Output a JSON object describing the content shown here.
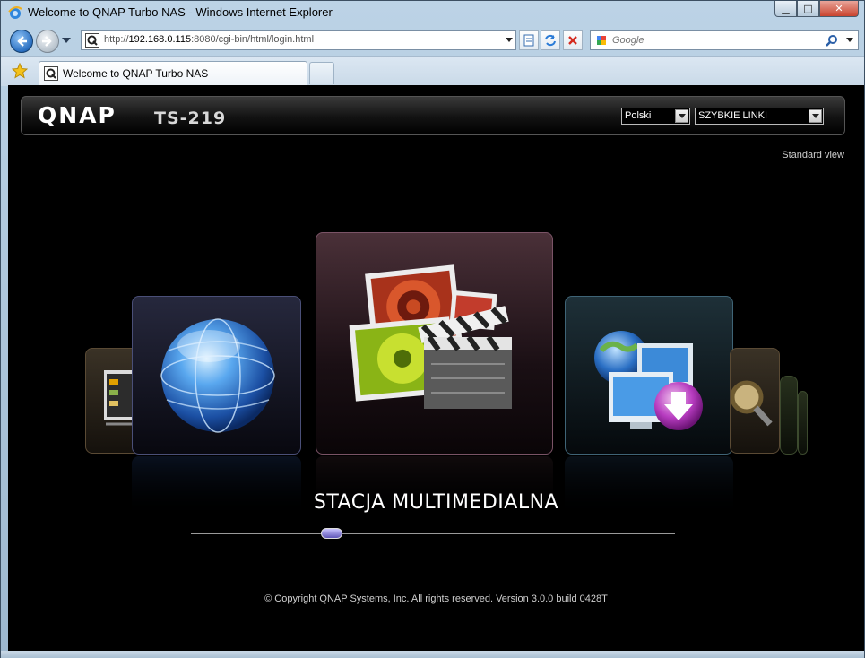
{
  "window": {
    "title": "Welcome to QNAP Turbo NAS - Windows Internet Explorer",
    "controls": {
      "minimize": "▁",
      "maximize": "□",
      "close": "✕"
    }
  },
  "navigation": {
    "url_prefix": "http://",
    "url_host": "192.168.0.115",
    "url_rest": ":8080/cgi-bin/html/login.html",
    "search_placeholder": "Google"
  },
  "tabs": [
    {
      "label": "Welcome to QNAP Turbo NAS",
      "active": true
    }
  ],
  "page": {
    "brand": "QNAP",
    "model": "TS-219",
    "language_select": "Polski",
    "quicklinks_select": "SZYBKIE LINKI",
    "standard_view_link": "Standard view",
    "carousel_caption": "STACJA MULTIMEDIALNA",
    "carousel_position": 0.29,
    "copyright": "© Copyright QNAP Systems, Inc. All rights reserved. Version 3.0.0 build 0428T",
    "carousel_items": [
      {
        "icon": "file-manager-icon"
      },
      {
        "icon": "globe-icon"
      },
      {
        "icon": "multimedia-icon"
      },
      {
        "icon": "download-station-icon"
      },
      {
        "icon": "search-icon"
      }
    ]
  },
  "colors": {
    "page_background": "#000000",
    "caption": "#ffffff",
    "slider_knob": "#7a70d0"
  }
}
